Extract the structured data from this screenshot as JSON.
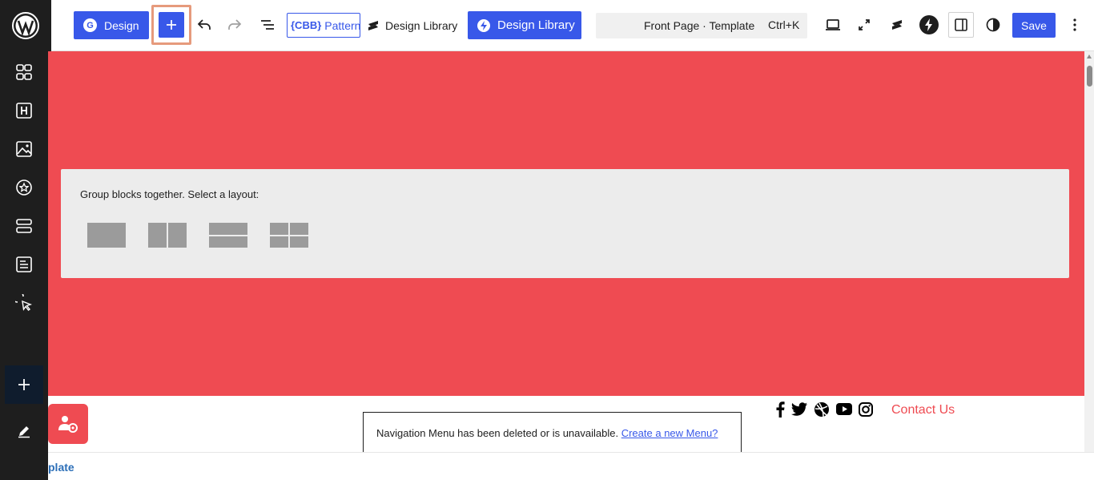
{
  "sidebar": {
    "logo_icon": "wordpress-logo-icon",
    "items": [
      {
        "name": "patterns-grid-icon"
      },
      {
        "name": "heading-block-icon"
      },
      {
        "name": "image-block-icon"
      },
      {
        "name": "star-circle-icon"
      },
      {
        "name": "layout-rows-icon"
      },
      {
        "name": "post-content-icon"
      },
      {
        "name": "cursor-click-icon"
      }
    ],
    "add_icon": "plus-icon",
    "edit_icon": "pencil-icon"
  },
  "toolbar": {
    "design_label": "Design",
    "design_badge": "G",
    "add_icon": "plus-icon",
    "undo_icon": "undo-icon",
    "redo_icon": "redo-icon",
    "outline_icon": "document-outline-icon",
    "pattern_badge": "{CBB}",
    "pattern_label": "Pattern",
    "design_library_text": "Design Library",
    "design_library_button": "Design Library",
    "command_title": "Front Page · Template",
    "command_shortcut": "Ctrl+K",
    "save_label": "Save",
    "accent_color": "#3858e9"
  },
  "canvas": {
    "cover_color": "#ef4b52",
    "group_prompt": "Group blocks together. Select a layout:",
    "layout_options": [
      "group",
      "row",
      "stack",
      "grid"
    ],
    "navigation_notice": "Navigation Menu has been deleted or is unavailable.",
    "navigation_link": "Create a new Menu?",
    "social_icons": [
      "facebook-icon",
      "twitter-icon",
      "dribbble-icon",
      "youtube-icon",
      "instagram-icon"
    ],
    "contact_label": "Contact Us"
  },
  "bottom": {
    "breadcrumb": "plate"
  }
}
